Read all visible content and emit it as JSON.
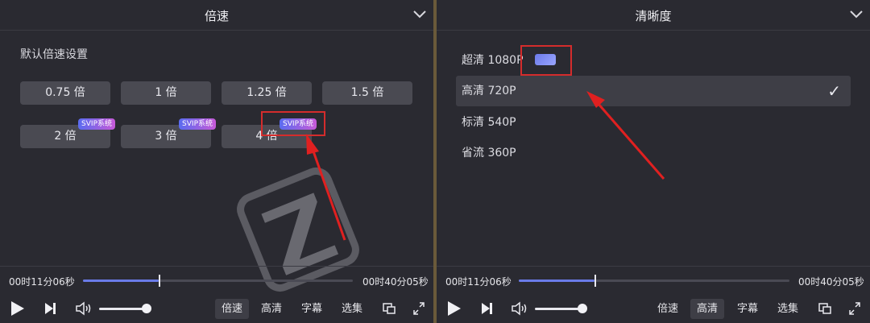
{
  "left": {
    "title": "倍速",
    "section_label": "默认倍速设置",
    "speeds": [
      {
        "label": "0.75 倍",
        "active": false,
        "badge": ""
      },
      {
        "label": "1 倍",
        "active": true,
        "badge": ""
      },
      {
        "label": "1.25 倍",
        "active": false,
        "badge": ""
      },
      {
        "label": "1.5 倍",
        "active": false,
        "badge": ""
      },
      {
        "label": "2 倍",
        "active": false,
        "badge": "SVIP系统"
      },
      {
        "label": "3 倍",
        "active": false,
        "badge": "SVIP系统"
      },
      {
        "label": "4 倍",
        "active": false,
        "badge": "SVIP系统"
      }
    ],
    "player": {
      "current_time": "00时11分06秒",
      "total_time": "00时40分05秒",
      "progress": 0.28,
      "volume": 0.9,
      "tabs": [
        {
          "label": "倍速",
          "active": true
        },
        {
          "label": "高清",
          "active": false
        },
        {
          "label": "字幕",
          "active": false
        },
        {
          "label": "选集",
          "active": false
        }
      ]
    }
  },
  "right": {
    "title": "清晰度",
    "qualities": [
      {
        "label": "超清 1080P",
        "selected": false,
        "hd_badge": true
      },
      {
        "label": "高清 720P",
        "selected": true,
        "hd_badge": false
      },
      {
        "label": "标清 540P",
        "selected": false,
        "hd_badge": false
      },
      {
        "label": "省流 360P",
        "selected": false,
        "hd_badge": false
      }
    ],
    "check_mark": "✓",
    "player": {
      "current_time": "00时11分06秒",
      "total_time": "00时40分05秒",
      "progress": 0.28,
      "volume": 0.9,
      "tabs": [
        {
          "label": "倍速",
          "active": false
        },
        {
          "label": "高清",
          "active": true
        },
        {
          "label": "字幕",
          "active": false
        },
        {
          "label": "选集",
          "active": false
        }
      ]
    }
  },
  "colors": {
    "panel_bg": "#2a2a31",
    "button_bg": "#4a4a52",
    "active_button_bg": "#4a5594",
    "progress_fill": "#6a7be8",
    "annotation_red": "#d42c2c"
  },
  "icons": {
    "collapse": "chevron-down-icon",
    "play": "play-icon",
    "next": "next-icon",
    "volume": "volume-icon",
    "pip": "picture-in-picture-icon",
    "fullscreen": "fullscreen-icon",
    "watermark": "watermark-logo"
  }
}
